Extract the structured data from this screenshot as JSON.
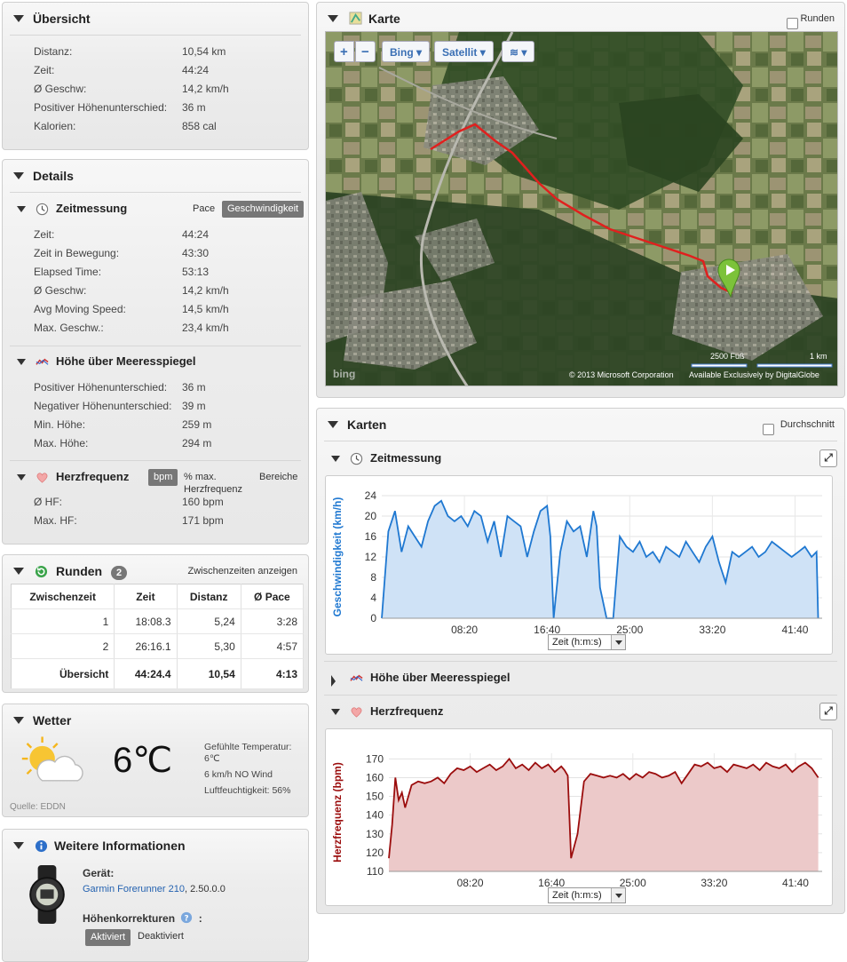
{
  "overview": {
    "title": "Übersicht",
    "rows": [
      {
        "k": "Distanz:",
        "v": "10,54 km"
      },
      {
        "k": "Zeit:",
        "v": "44:24"
      },
      {
        "k": "Ø Geschw:",
        "v": "14,2 km/h"
      },
      {
        "k": "Positiver Höhenunterschied:",
        "v": "36 m"
      },
      {
        "k": "Kalorien:",
        "v": "858 cal"
      }
    ]
  },
  "details": {
    "title": "Details",
    "timing": {
      "title": "Zeitmessung",
      "pace_label": "Pace",
      "speed_label": "Geschwindigkeit",
      "rows": [
        {
          "k": "Zeit:",
          "v": "44:24"
        },
        {
          "k": "Zeit in Bewegung:",
          "v": "43:30"
        },
        {
          "k": "Elapsed Time:",
          "v": "53:13"
        },
        {
          "k": "Ø Geschw:",
          "v": "14,2 km/h"
        },
        {
          "k": "Avg Moving Speed:",
          "v": "14,5 km/h"
        },
        {
          "k": "Max. Geschw.:",
          "v": "23,4 km/h"
        }
      ]
    },
    "elevation": {
      "title": "Höhe über Meeresspiegel",
      "rows": [
        {
          "k": "Positiver Höhenunterschied:",
          "v": "36 m"
        },
        {
          "k": "Negativer Höhenunterschied:",
          "v": "39 m"
        },
        {
          "k": "Min. Höhe:",
          "v": "259 m"
        },
        {
          "k": "Max. Höhe:",
          "v": "294 m"
        }
      ]
    },
    "heartrate": {
      "title": "Herzfrequenz",
      "bpm_label": "bpm",
      "pct_label": "% max. Herzfrequenz",
      "zones_label": "Bereiche",
      "rows": [
        {
          "k": "Ø HF:",
          "v": "160 bpm"
        },
        {
          "k": "Max. HF:",
          "v": "171 bpm"
        }
      ]
    }
  },
  "laps": {
    "title": "Runden",
    "count": "2",
    "splits_link": "Zwischenzeiten anzeigen",
    "headers": [
      "Zwischenzeit",
      "Zeit",
      "Distanz",
      "Ø Pace"
    ],
    "rows": [
      [
        "1",
        "18:08.3",
        "5,24",
        "3:28"
      ],
      [
        "2",
        "26:16.1",
        "5,30",
        "4:57"
      ]
    ],
    "total": [
      "Übersicht",
      "44:24.4",
      "10,54",
      "4:13"
    ]
  },
  "weather": {
    "title": "Wetter",
    "temp": "6℃",
    "feels": "Gefühlte Temperatur: 6℃",
    "wind": "6 km/h NO Wind",
    "humidity": "Luftfeuchtigkeit: 56%",
    "source": "Quelle: EDDN"
  },
  "info": {
    "title": "Weitere Informationen",
    "device_label": "Gerät:",
    "device_name": "Garmin Forerunner 210",
    "device_version": ", 2.50.0.0",
    "elev_corr_label": "Höhenkorrekturen",
    "elev_corr_colon": ":",
    "on_label": "Aktiviert",
    "off_label": "Deaktiviert"
  },
  "map": {
    "title": "Karte",
    "laps_checkbox": "Runden",
    "zoom_in": "+",
    "zoom_out": "−",
    "provider": "Bing",
    "maptype": "Satellit",
    "scale_ft": "2500 Fuß",
    "scale_km": "1 km",
    "copyright": "© 2013 Microsoft Corporation",
    "imagery": "Available Exclusively by DigitalGlobe",
    "brand": "bing"
  },
  "charts": {
    "title": "Karten",
    "avg_checkbox": "Durchschnitt",
    "speed_title": "Zeitmessung",
    "elev_title": "Höhe über Meeresspiegel",
    "hr_title": "Herzfrequenz",
    "x_select": "Zeit (h:m:s)"
  },
  "colors": {
    "speed": "#1f78d1",
    "speed_fill": "#cfe2f6",
    "hr": "#9b0d0d",
    "hr_fill": "#ecc9c9",
    "route": "#e0201e"
  },
  "chart_data": [
    {
      "type": "area",
      "ylabel": "Geschwindigkeit (km/h)",
      "yticks": [
        0,
        4,
        8,
        12,
        16,
        20,
        24
      ],
      "ylim": [
        0,
        24
      ],
      "xlim": [
        0,
        2664
      ],
      "xticks": [
        500,
        1000,
        1500,
        2000,
        2500
      ],
      "xtick_labels": [
        "08:20",
        "16:40",
        "25:00",
        "33:20",
        "41:40"
      ],
      "grid": true,
      "x": [
        0,
        40,
        80,
        120,
        160,
        200,
        240,
        280,
        320,
        360,
        400,
        440,
        480,
        520,
        560,
        600,
        640,
        680,
        720,
        760,
        800,
        840,
        880,
        920,
        960,
        1000,
        1020,
        1040,
        1080,
        1120,
        1160,
        1200,
        1240,
        1280,
        1300,
        1320,
        1360,
        1400,
        1440,
        1480,
        1520,
        1560,
        1600,
        1640,
        1680,
        1720,
        1760,
        1800,
        1840,
        1880,
        1920,
        1960,
        2000,
        2040,
        2080,
        2120,
        2160,
        2200,
        2240,
        2280,
        2320,
        2360,
        2400,
        2440,
        2480,
        2520,
        2560,
        2600,
        2630,
        2640
      ],
      "y": [
        0,
        17,
        21,
        13,
        18,
        16,
        14,
        19,
        22,
        23,
        20,
        19,
        20,
        18,
        21,
        20,
        15,
        19,
        12,
        20,
        19,
        18,
        12,
        17,
        21,
        22,
        16,
        0,
        13,
        19,
        17,
        18,
        12,
        21,
        18,
        6,
        0,
        0,
        16,
        14,
        13,
        15,
        12,
        13,
        11,
        14,
        13,
        12,
        15,
        13,
        11,
        14,
        16,
        11,
        7,
        13,
        12,
        13,
        14,
        12,
        13,
        15,
        14,
        13,
        12,
        13,
        14,
        12,
        13,
        0
      ]
    },
    {
      "type": "area",
      "ylabel": "Herzfrequenz (bpm)",
      "yticks": [
        110,
        120,
        130,
        140,
        150,
        160,
        170
      ],
      "ylim": [
        110,
        173
      ],
      "xlim": [
        0,
        2664
      ],
      "xticks": [
        500,
        1000,
        1500,
        2000,
        2500
      ],
      "xtick_labels": [
        "08:20",
        "16:40",
        "25:00",
        "33:20",
        "41:40"
      ],
      "grid": true,
      "x": [
        0,
        20,
        40,
        60,
        80,
        100,
        140,
        180,
        220,
        260,
        300,
        340,
        380,
        420,
        460,
        500,
        540,
        580,
        620,
        660,
        700,
        740,
        780,
        820,
        860,
        900,
        940,
        980,
        1020,
        1060,
        1080,
        1100,
        1120,
        1160,
        1200,
        1240,
        1280,
        1320,
        1360,
        1400,
        1440,
        1480,
        1520,
        1560,
        1600,
        1640,
        1680,
        1720,
        1760,
        1800,
        1840,
        1880,
        1920,
        1960,
        2000,
        2040,
        2080,
        2120,
        2160,
        2200,
        2240,
        2280,
        2320,
        2360,
        2400,
        2440,
        2480,
        2520,
        2560,
        2600,
        2640
      ],
      "y": [
        117,
        135,
        160,
        148,
        152,
        144,
        156,
        158,
        157,
        158,
        160,
        157,
        162,
        165,
        164,
        166,
        163,
        165,
        167,
        164,
        166,
        170,
        165,
        167,
        164,
        168,
        165,
        167,
        163,
        166,
        164,
        161,
        117,
        130,
        158,
        162,
        161,
        160,
        161,
        160,
        162,
        159,
        162,
        160,
        163,
        162,
        160,
        161,
        163,
        157,
        162,
        167,
        166,
        168,
        165,
        166,
        163,
        167,
        166,
        165,
        167,
        164,
        168,
        166,
        165,
        167,
        163,
        166,
        168,
        165,
        160
      ]
    }
  ]
}
